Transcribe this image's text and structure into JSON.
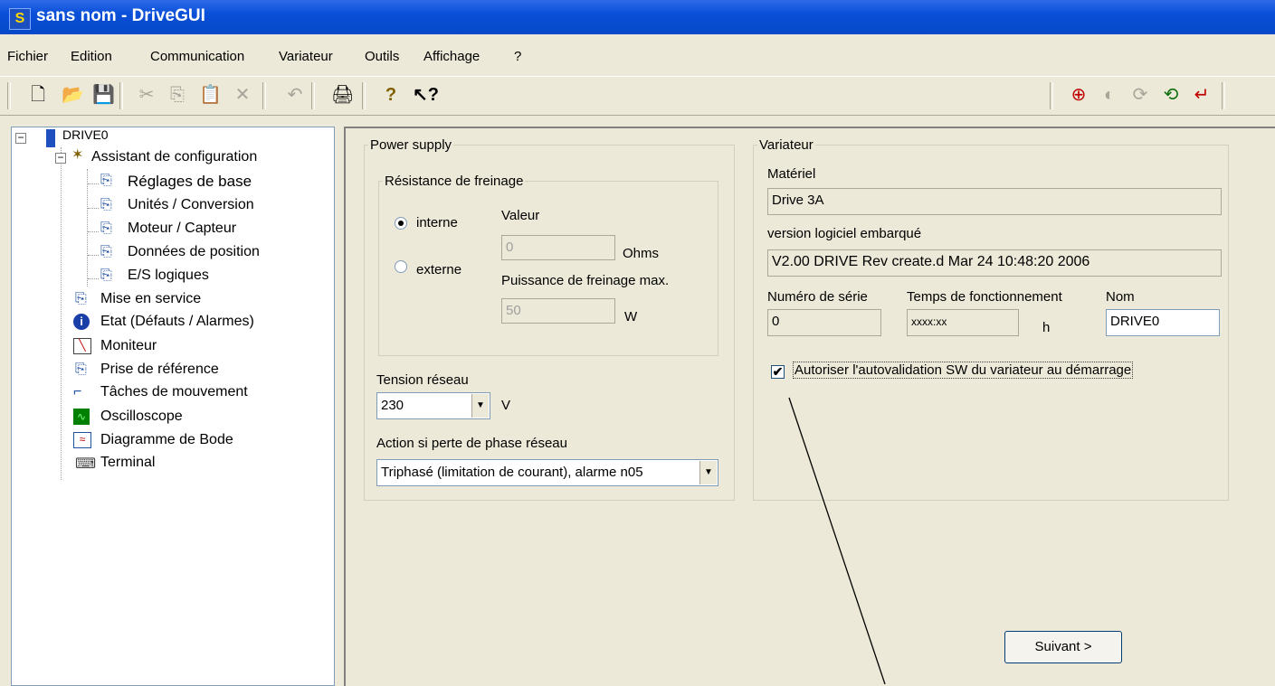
{
  "window": {
    "title": "sans nom - DriveGUI",
    "icon": "S"
  },
  "menu": [
    "Fichier",
    "Edition",
    "Communication",
    "Variateur",
    "Outils",
    "Affichage",
    "?"
  ],
  "tree": {
    "root": "DRIVE0",
    "wizard": "Assistant de configuration",
    "wizard_items": [
      "Réglages de base",
      "Unités / Conversion",
      "Moteur / Capteur",
      "Données de position",
      "E/S logiques"
    ],
    "items": [
      "Mise en service",
      "Etat (Défauts / Alarmes)",
      "Moniteur",
      "Prise de référence",
      "Tâches de mouvement",
      "Oscilloscope",
      "Diagramme de Bode",
      "Terminal"
    ]
  },
  "power": {
    "legend": "Power supply",
    "brake_legend": "Résistance de freinage",
    "interne": "interne",
    "externe": "externe",
    "value_label": "Valeur",
    "value": "0",
    "value_unit": "Ohms",
    "power_label": "Puissance de freinage max.",
    "power": "50",
    "power_unit": "W",
    "voltage_label": "Tension réseau",
    "voltage": "230",
    "voltage_unit": "V",
    "phase_label": "Action si perte de phase réseau",
    "phase": "Triphasé (limitation de courant), alarme n05"
  },
  "drive": {
    "legend": "Variateur",
    "hw_label": "Matériel",
    "hw": "Drive 3A",
    "fw_label": "version logiciel embarqué",
    "fw": "V2.00 DRIVE Rev create.d Mar 24 10:48:20 2006",
    "serial_label": "Numéro de série",
    "serial": "0",
    "time_label": "Temps de fonctionnement",
    "time": "xxxx:xx",
    "time_unit": "h",
    "name_label": "Nom",
    "name": "DRIVE0",
    "auto_label": "Autoriser l'autovalidation SW du variateur au démarrage",
    "auto_checked": "✔"
  },
  "next_button": "Suivant >"
}
